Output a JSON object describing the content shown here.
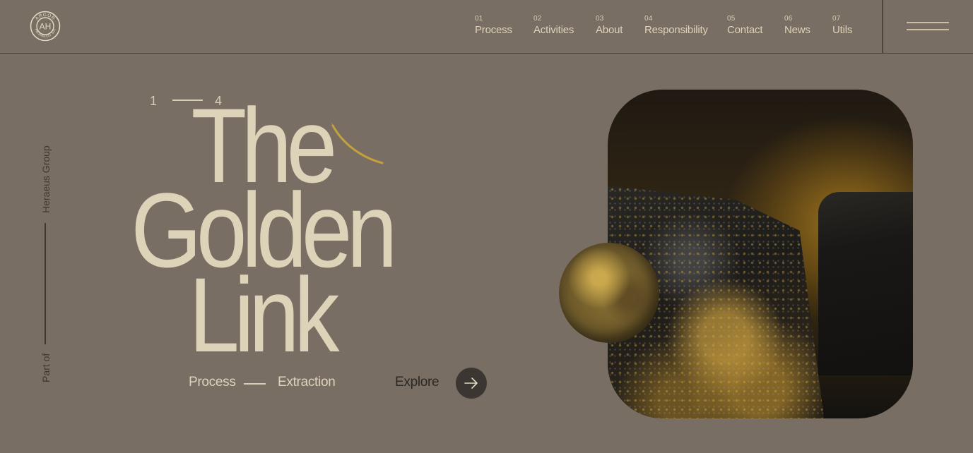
{
  "brand": {
    "logo_top_text": "ARGOR",
    "logo_monogram": "AH",
    "logo_bottom_text": "HERAEUS SA",
    "logo_icon": "argor-heraeus-logo-icon"
  },
  "nav": {
    "items": [
      {
        "num": "01",
        "label": "Process"
      },
      {
        "num": "02",
        "label": "Activities"
      },
      {
        "num": "03",
        "label": "About"
      },
      {
        "num": "04",
        "label": "Responsibility"
      },
      {
        "num": "05",
        "label": "Contact"
      },
      {
        "num": "06",
        "label": "News"
      },
      {
        "num": "07",
        "label": "Utils"
      }
    ],
    "menu_icon": "hamburger-menu-icon"
  },
  "side": {
    "top_text": "Heraeus Group",
    "bottom_text": "Part of"
  },
  "hero": {
    "counter_current": "1",
    "counter_total": "4",
    "title_lines": [
      "The",
      "Golden",
      "Link"
    ],
    "crumb_from": "Process",
    "crumb_to": "Extraction",
    "explore_label": "Explore",
    "explore_icon": "arrow-right-icon"
  },
  "colors": {
    "background": "#786e64",
    "text_light": "#dcd3b8",
    "text_dark": "#2c2823",
    "accent_gold": "#c9a33a",
    "button_dark": "#3b3631",
    "divider": "#4d463f"
  }
}
